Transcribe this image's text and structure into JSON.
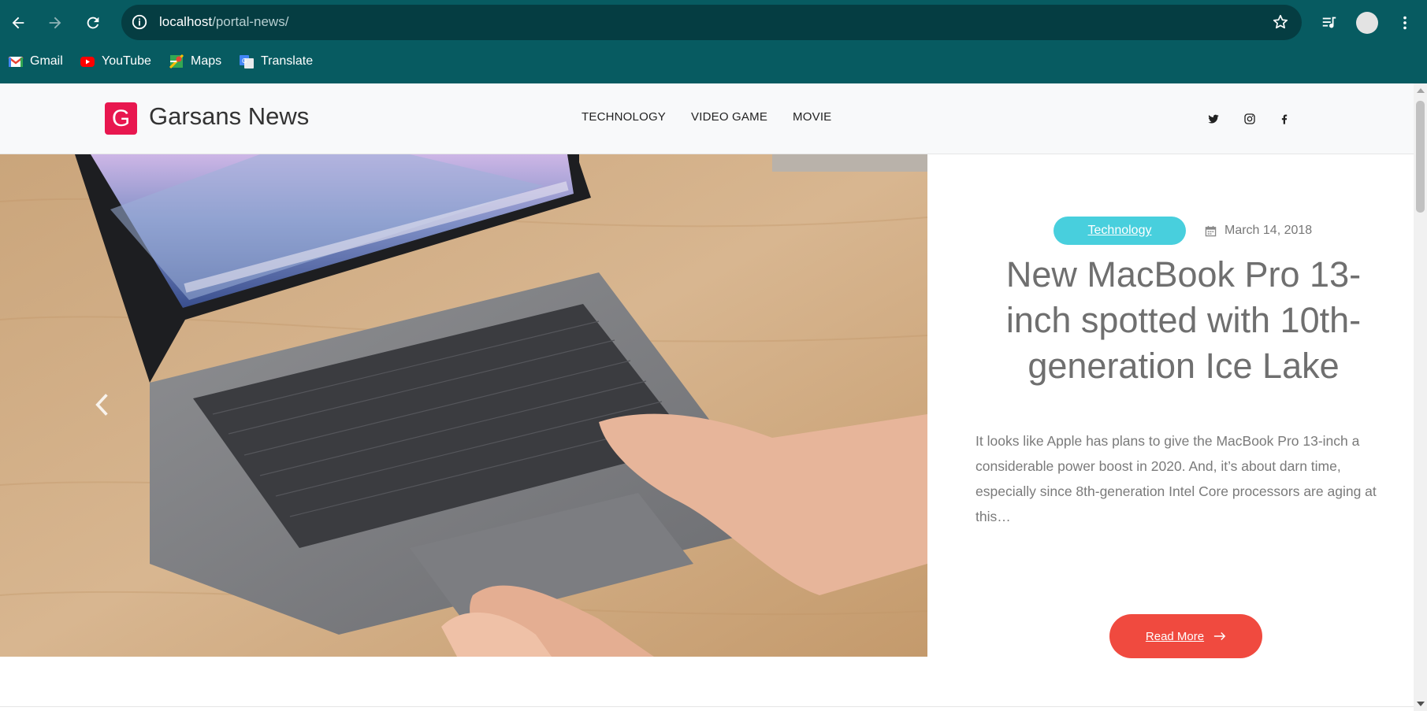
{
  "browser": {
    "url_host": "localhost",
    "url_path": "/portal-news/",
    "bookmarks": [
      {
        "label": "Gmail",
        "icon": "gmail-icon"
      },
      {
        "label": "YouTube",
        "icon": "youtube-icon"
      },
      {
        "label": "Maps",
        "icon": "maps-icon"
      },
      {
        "label": "Translate",
        "icon": "translate-icon"
      }
    ],
    "colors": {
      "chrome": "#075b61",
      "omnibox": "#053d42"
    }
  },
  "site": {
    "logo_letter": "G",
    "name": "Garsans News",
    "nav": [
      "TECHNOLOGY",
      "VIDEO GAME",
      "MOVIE"
    ],
    "social": [
      "twitter-icon",
      "instagram-icon",
      "facebook-icon"
    ],
    "colors": {
      "logo": "#e8174f",
      "badge": "#48cfdd",
      "button": "#f04a3f"
    }
  },
  "hero": {
    "category": "Technology",
    "date": "March 14, 2018",
    "title": "New MacBook Pro 13-inch spotted with 10th-generation Ice Lake",
    "excerpt": "It looks like Apple has plans to give the MacBook Pro 13-inch a considerable power boost in 2020. And, it’s about darn time, especially since 8th-generation Intel Core processors are aging at this…",
    "read_more": "Read More",
    "image_label": "MacBook Pro"
  }
}
